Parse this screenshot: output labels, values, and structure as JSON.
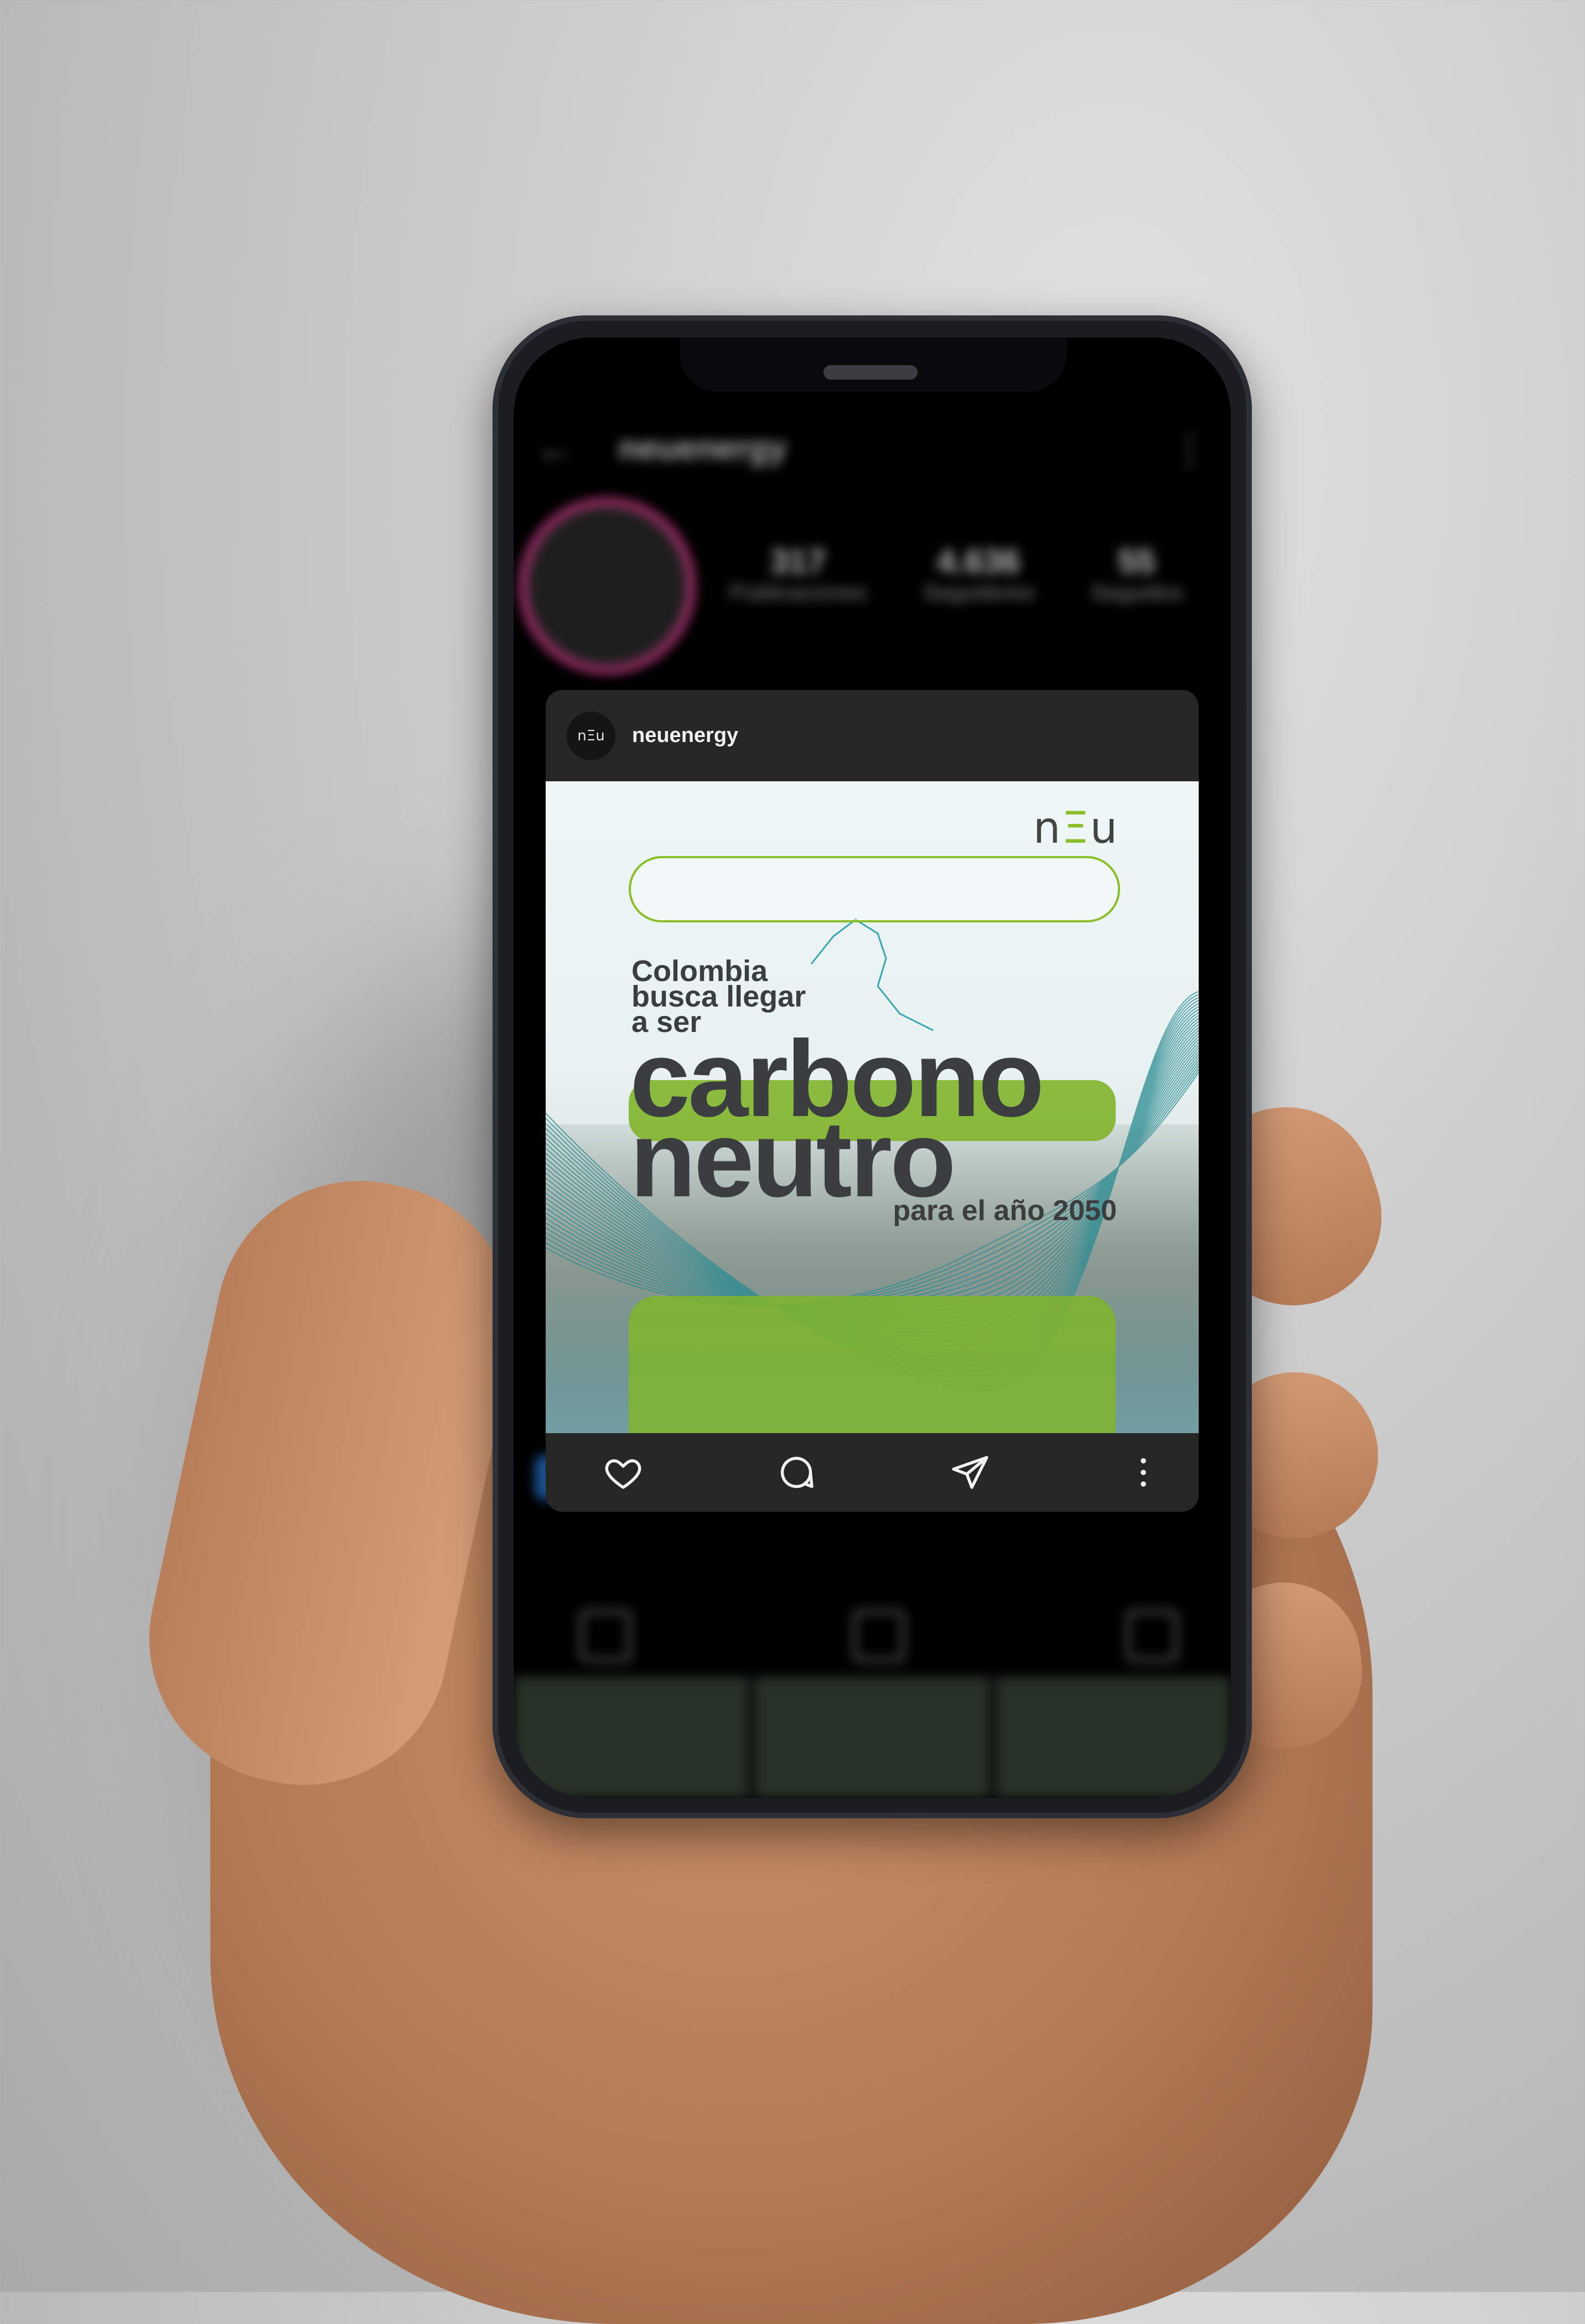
{
  "background_app": {
    "username": "neuenergy",
    "stats": [
      {
        "number": "317",
        "label": "Publicaciones"
      },
      {
        "number": "4.636",
        "label": "Seguidores"
      },
      {
        "number": "55",
        "label": "Seguidos"
      }
    ]
  },
  "post": {
    "username": "neuenergy",
    "avatar_text": "nΞu",
    "image": {
      "logo_left": "n",
      "logo_mid": "Ξ",
      "logo_right": "u",
      "headline_small": [
        "Colombia",
        "busca llegar",
        "a ser"
      ],
      "headline_big": [
        "carbono",
        "neutro"
      ],
      "subline": "para el año 2050"
    },
    "actions": [
      "heart-icon",
      "comment-icon",
      "share-icon",
      "more-icon"
    ]
  },
  "colors": {
    "accent_green": "#7fb52a",
    "text_dark": "#3b3d3e",
    "card_bg": "#262626",
    "teal_lines": "#2a8c93"
  }
}
